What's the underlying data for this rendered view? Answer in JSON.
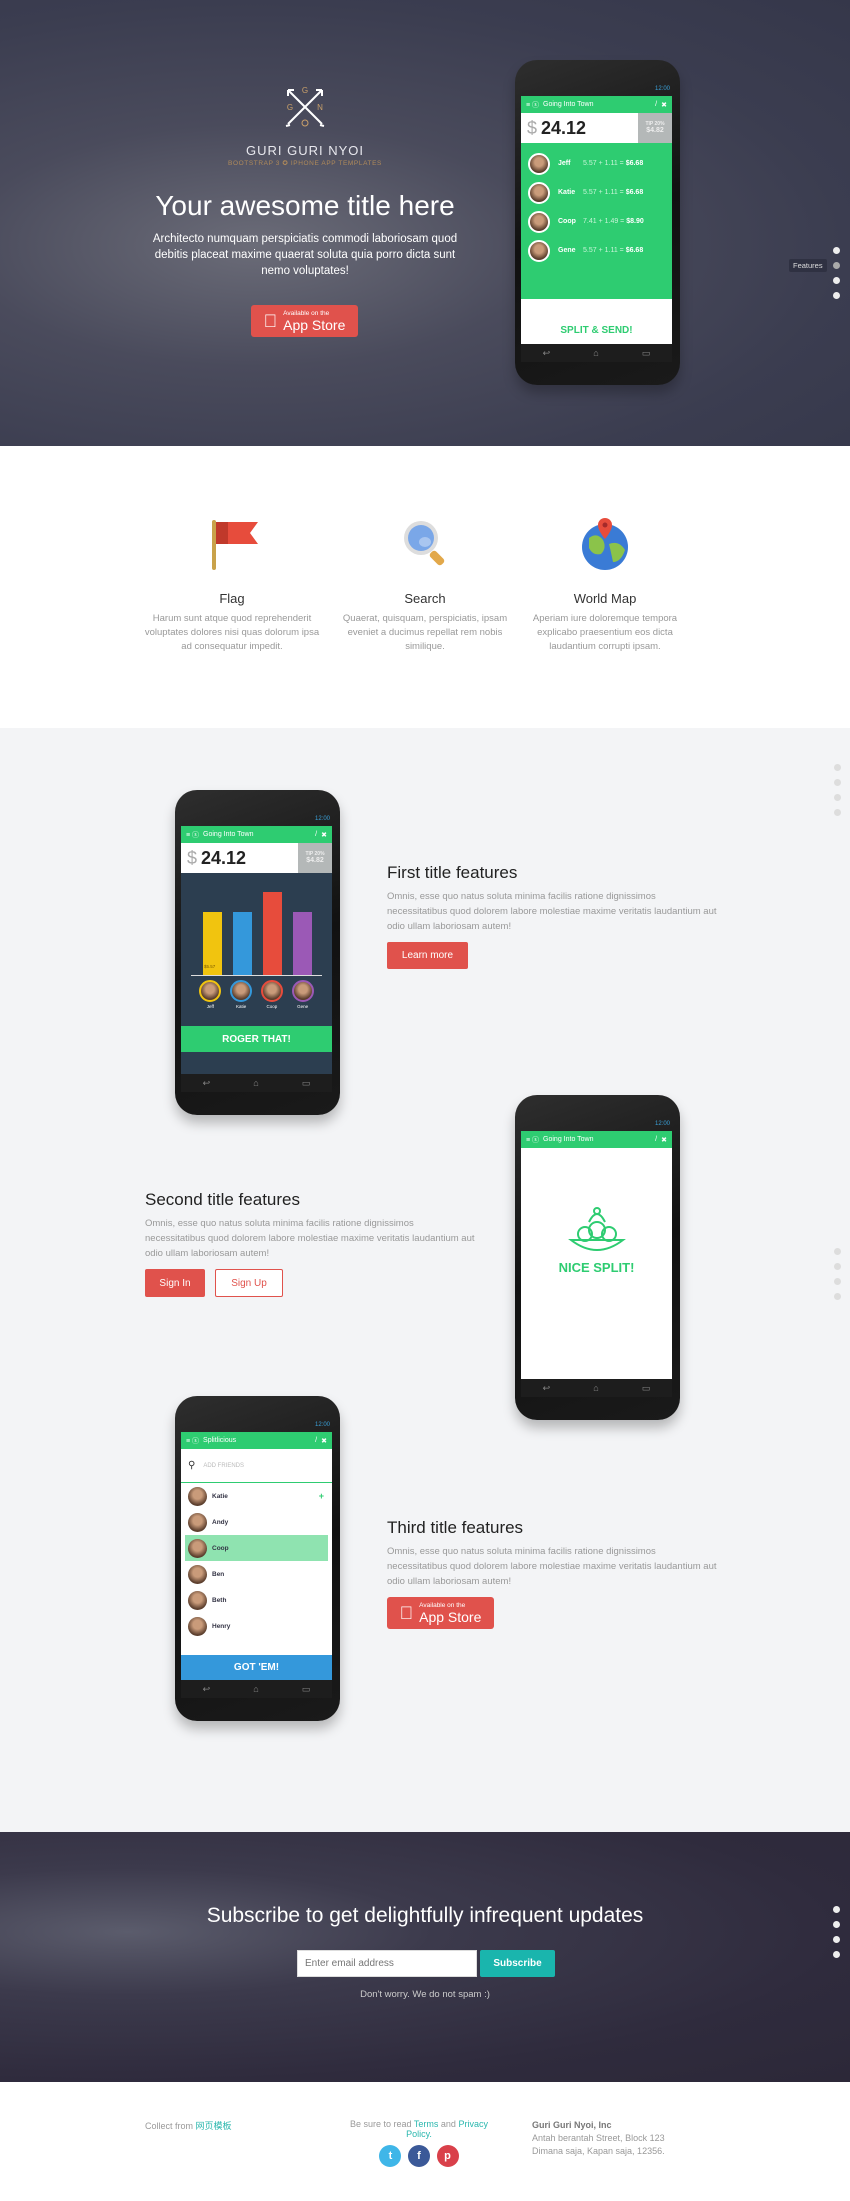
{
  "hero": {
    "logo_letters": [
      "G",
      "G",
      "N",
      "O"
    ],
    "brand": "GURI GURI NYOI",
    "tagline": "BOOTSTRAP 3 ✪ IPHONE APP TEMPLATES",
    "title": "Your awesome title here",
    "text": "Architecto numquam perspiciatis commodi laboriosam quod debitis placeat maxime quaerat soluta quia porro dicta sunt nemo voluptates!",
    "appstore_small": "Available on the",
    "appstore_big": "App Store"
  },
  "side_nav": {
    "tooltip": "Features",
    "active_index": 1
  },
  "phone_common": {
    "time": "12:00",
    "app_title": "Going Into Town",
    "amount_symbol": "$",
    "amount": "24.12",
    "tip_label": "TIP 20%",
    "tip_value": "$4.82"
  },
  "phone1": {
    "people": [
      {
        "name": "Jeff",
        "calc": "5.57 + 1.11 =",
        "total": "$6.68"
      },
      {
        "name": "Katie",
        "calc": "5.57 + 1.11 =",
        "total": "$6.68"
      },
      {
        "name": "Coop",
        "calc": "7.41 + 1.49 =",
        "total": "$8.90"
      },
      {
        "name": "Gene",
        "calc": "5.57 + 1.11 =",
        "total": "$6.68"
      }
    ],
    "button": "SPLIT & SEND!"
  },
  "features": [
    {
      "icon": "flag-icon",
      "title": "Flag",
      "text": "Harum sunt atque quod reprehenderit voluptates dolores nisi quas dolorum ipsa ad consequatur impedit."
    },
    {
      "icon": "search-icon",
      "title": "Search",
      "text": "Quaerat, quisquam, perspiciatis, ipsam eveniet a ducimus repellat rem nobis similique."
    },
    {
      "icon": "world-map-icon",
      "title": "World Map",
      "text": "Aperiam iure doloremque tempora explicabo praesentium eos dicta laudantium corrupti ipsam."
    }
  ],
  "showcase": {
    "first": {
      "title": "First title features",
      "text": "Omnis, esse quo natus soluta minima facilis ratione dignissimos necessitatibus quod dolorem labore molestiae maxime veritatis laudantium aut odio ullam laboriosam autem!",
      "button": "Learn more"
    },
    "second": {
      "title": "Second title features",
      "text": "Omnis, esse quo natus soluta minima facilis ratione dignissimos necessitatibus quod dolorem labore molestiae maxime veritatis laudantium aut odio ullam laboriosam autem!",
      "sign_in": "Sign In",
      "sign_up": "Sign Up"
    },
    "third": {
      "title": "Third title features",
      "text": "Omnis, esse quo natus soluta minima facilis ratione dignissimos necessitatibus quod dolorem labore molestiae maxime veritatis laudantium aut odio ullam laboriosam autem!",
      "appstore_small": "Available on the",
      "appstore_big": "App Store"
    }
  },
  "phone2": {
    "bar_label": "$5.57",
    "bars": [
      {
        "name": "Jeff",
        "value": 5.57,
        "color": "#f1c40f"
      },
      {
        "name": "Katie",
        "value": 5.57,
        "color": "#3498db"
      },
      {
        "name": "Coop",
        "value": 7.41,
        "color": "#e74c3c"
      },
      {
        "name": "Gene",
        "value": 5.57,
        "color": "#9b59b6"
      }
    ],
    "button": "ROGER THAT!"
  },
  "phone3": {
    "message": "NICE SPLIT!"
  },
  "phone4": {
    "app_title": "Splitlicious",
    "search_placeholder": "ADD FRIENDS",
    "friends": [
      "Katie",
      "Andy",
      "Coop",
      "Ben",
      "Beth",
      "Henry"
    ],
    "selected": "Coop",
    "button": "GOT 'EM!"
  },
  "subscribe": {
    "title": "Subscribe to get delightfully infrequent updates",
    "placeholder": "Enter email address",
    "button": "Subscribe",
    "note": "Don't worry. We do not spam :)"
  },
  "footer": {
    "collect": "Collect from",
    "collect_link": "网页模板",
    "read": "Be sure to read",
    "terms": "Terms",
    "and": "and",
    "privacy": "Privacy Policy.",
    "company": "Guri Guri Nyoi, Inc",
    "address1": "Antah berantah Street, Block 123",
    "address2": "Dimana saja, Kapan saja, 12356."
  },
  "colors": {
    "accent_red": "#e0524c",
    "app_green": "#2ecc71",
    "teal": "#1abc9c",
    "blue": "#3498db"
  }
}
